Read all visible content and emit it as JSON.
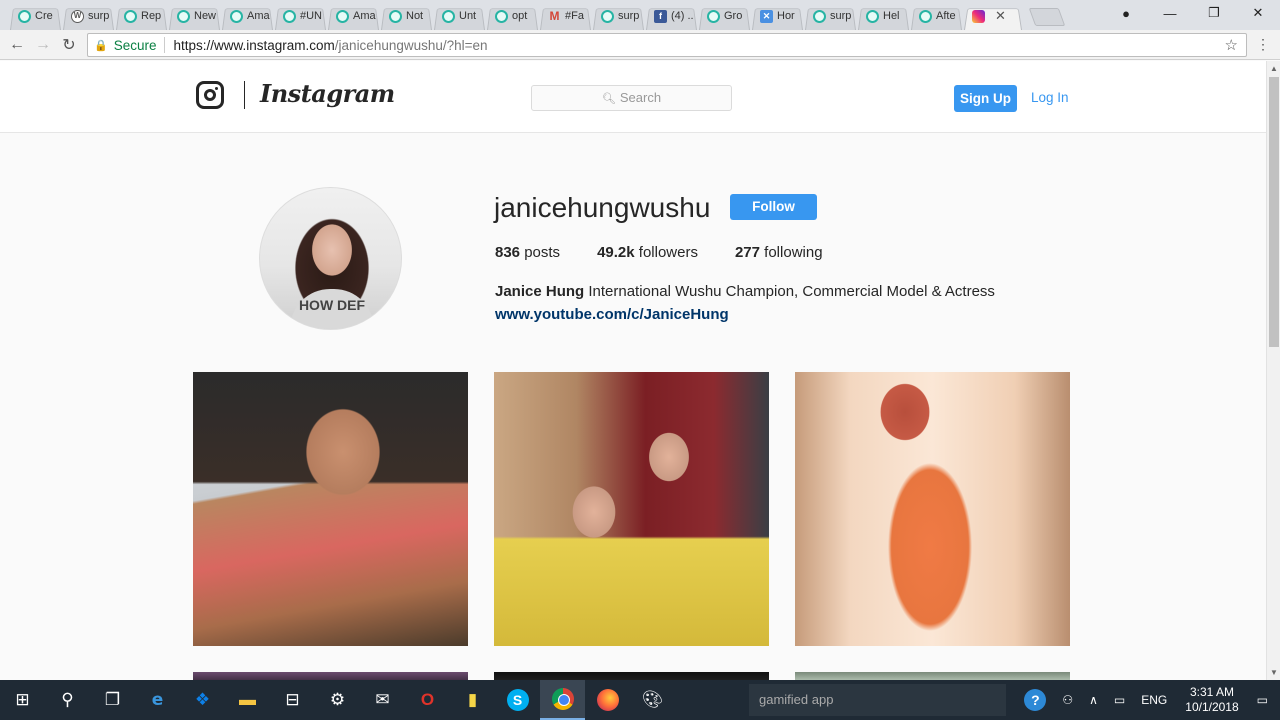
{
  "browser": {
    "tabs": [
      {
        "label": "Cre",
        "icon": "site-icon",
        "active": false
      },
      {
        "label": "surp",
        "icon": "wordpress-icon",
        "active": false
      },
      {
        "label": "Rep",
        "icon": "site-icon",
        "active": false
      },
      {
        "label": "New",
        "icon": "site-icon",
        "active": false
      },
      {
        "label": "Ama",
        "icon": "site-icon",
        "active": false
      },
      {
        "label": "#UN",
        "icon": "site-icon",
        "active": false
      },
      {
        "label": "Ama",
        "icon": "site-icon",
        "active": false
      },
      {
        "label": "Not",
        "icon": "site-icon",
        "active": false
      },
      {
        "label": "Unt",
        "icon": "site-icon",
        "active": false
      },
      {
        "label": "opt",
        "icon": "site-icon",
        "active": false
      },
      {
        "label": "#Fa",
        "icon": "gmail-icon",
        "active": false
      },
      {
        "label": "surp",
        "icon": "site-icon",
        "active": false
      },
      {
        "label": "(4) ..",
        "icon": "facebook-icon",
        "active": false
      },
      {
        "label": "Gro",
        "icon": "site-icon",
        "active": false
      },
      {
        "label": "Hor",
        "icon": "x-icon",
        "active": false
      },
      {
        "label": "surp",
        "icon": "site-icon",
        "active": false
      },
      {
        "label": "Hel",
        "icon": "site-icon",
        "active": false
      },
      {
        "label": "Afte",
        "icon": "site-icon",
        "active": false
      },
      {
        "label": "",
        "icon": "instagram-icon",
        "active": true
      }
    ],
    "secure_label": "Secure",
    "url_host": "https://www.instagram.com",
    "url_path": "/janicehungwushu/?hl=en"
  },
  "header": {
    "wordmark": "Instagram",
    "search_placeholder": "Search",
    "signup_label": "Sign Up",
    "login_label": "Log In"
  },
  "profile": {
    "username": "janicehungwushu",
    "follow_label": "Follow",
    "stats": [
      {
        "value": "836",
        "label": "posts"
      },
      {
        "value": "49.2k",
        "label": "followers"
      },
      {
        "value": "277",
        "label": "following"
      }
    ],
    "full_name": "Janice Hung",
    "bio": "International Wushu Champion, Commercial Model & Actress",
    "link": "www.youtube.com/c/JaniceHung",
    "avatar_shirt_text": "HOW DEF"
  },
  "taskbar": {
    "search_text": "gamified app",
    "language": "ENG",
    "time": "3:31 AM",
    "date": "10/1/2018"
  },
  "colors": {
    "accent": "#3897f0",
    "link": "#003569",
    "taskbar": "#1f2a35"
  }
}
